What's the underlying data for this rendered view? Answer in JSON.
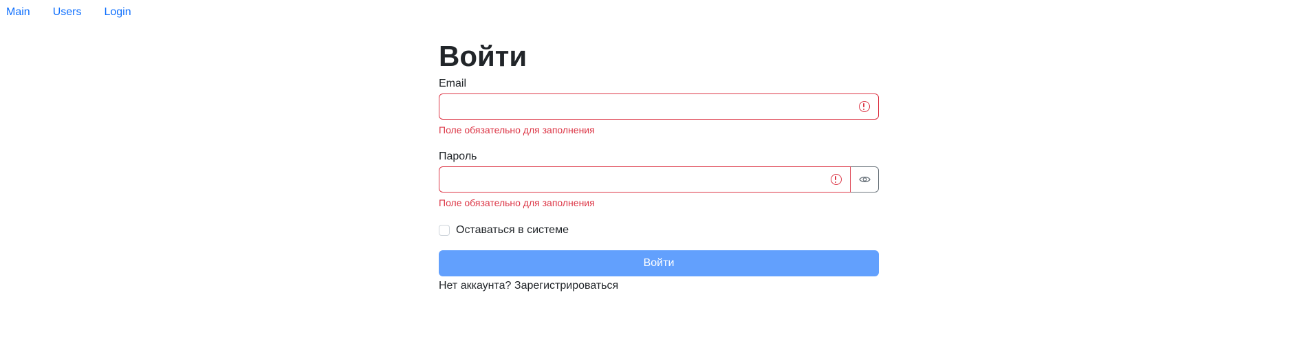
{
  "nav": {
    "items": [
      "Main",
      "Users",
      "Login"
    ]
  },
  "form": {
    "title": "Войти",
    "email": {
      "label": "Email",
      "value": "",
      "placeholder": "",
      "error": "Поле обязательно для заполнения"
    },
    "password": {
      "label": "Пароль",
      "value": "",
      "placeholder": "",
      "error": "Поле обязательно для заполнения",
      "toggle_icon": "eye-icon"
    },
    "remember": {
      "label": "Оставаться в системе",
      "checked": false
    },
    "submit_label": "Войти",
    "register": {
      "prompt": "Нет аккаунта?",
      "link": "Зарегистрироваться"
    }
  },
  "colors": {
    "link": "#0d6efd",
    "error": "#dc3545",
    "button": "#62a0fd",
    "text": "#212529"
  }
}
